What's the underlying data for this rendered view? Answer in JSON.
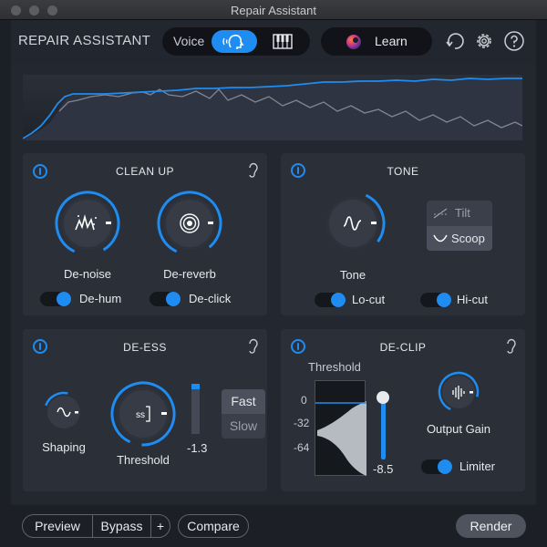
{
  "window": {
    "title": "Repair Assistant"
  },
  "header": {
    "app_title": "REPAIR ASSISTANT",
    "mode": {
      "voice_label": "Voice",
      "selected": "voice"
    },
    "learn_label": "Learn"
  },
  "clean_up": {
    "title": "CLEAN UP",
    "denoise_label": "De-noise",
    "dereverb_label": "De-reverb",
    "dehum_label": "De-hum",
    "declick_label": "De-click",
    "dehum_on": true,
    "declick_on": true
  },
  "tone": {
    "title": "TONE",
    "tone_label": "Tone",
    "options": [
      "Tilt",
      "Scoop"
    ],
    "selected": "Scoop",
    "locut_label": "Lo-cut",
    "hicut_label": "Hi-cut",
    "locut_on": true,
    "hicut_on": true
  },
  "de_ess": {
    "title": "DE-ESS",
    "shaping_label": "Shaping",
    "threshold_label": "Threshold",
    "threshold_value": "-1.3",
    "speed_options": [
      "Fast",
      "Slow"
    ],
    "speed_selected": "Fast"
  },
  "de_clip": {
    "title": "DE-CLIP",
    "threshold_label": "Threshold",
    "scale": [
      "0",
      "-32",
      "-64"
    ],
    "threshold_value": "-8.5",
    "output_gain_label": "Output Gain",
    "limiter_label": "Limiter",
    "limiter_on": true
  },
  "bottom": {
    "preview_label": "Preview",
    "bypass_label": "Bypass",
    "plus_label": "+",
    "compare_label": "Compare",
    "render_label": "Render"
  },
  "colors": {
    "accent": "#1e8cf0",
    "panel": "#2b2f38",
    "background": "#23272f"
  }
}
